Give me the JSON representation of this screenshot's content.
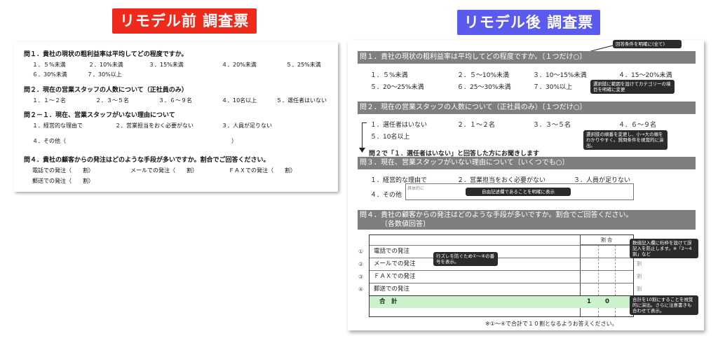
{
  "banners": {
    "before": "リモデル前 調査票",
    "after": "リモデル後 調査票"
  },
  "before": {
    "q1": {
      "title": "問１．貴社の現状の粗利益率は平均してどの程度ですか。",
      "options": [
        "１．５%未満",
        "２．10%未満",
        "３．15%未満",
        "４．20%未満",
        "５．25%未満",
        "６．30%未満",
        "７．30%以上"
      ]
    },
    "q2": {
      "title": "問２．現在の営業スタッフの人数について（正社員のみ）",
      "options": [
        "１．１～２名",
        "２．３～５名",
        "３．６～９名",
        "４．10名以上",
        "５．選任者はいない"
      ]
    },
    "q21": {
      "title": "問２－１．現在、営業スタッフがいない理由について",
      "options": [
        "１．経営的な理由で",
        "２．営業担当をおく必要がない",
        "３．人員が足りない",
        "４．その他（",
        "）"
      ]
    },
    "q4": {
      "title": "問４．貴社の顧客からの発注はどのような手段が多いですか。割合でご回答ください。",
      "items": [
        "電話での発注（　　割）",
        "メールでの発注（　　割）",
        "ＦＡＸでの発注（　　割）",
        "郵送での発注（　　割）"
      ]
    }
  },
  "after": {
    "notes": {
      "n1": "回答条件を明確に(全て)",
      "n2": "選択肢に範囲を設けてカテゴリーの境目を明確に変更",
      "n3": "選択肢の順番を変更し、小→大の順をわかりやすく。質問条件を視覚的に演出。",
      "n4": "自由記述欄であることを明確に表示",
      "n5": "行ズレを防ぐため①～④の番号を表示。",
      "n6": "数値記入欄に桁枠を設けて誤記入を防止します。※「2～4割」など",
      "n7": "合計を10割にすることを視覚的に演出。さらに注意書きも合わせて表示。"
    },
    "q1": {
      "title": "問１．貴社の現状の粗利益率は平均してどの程度ですか。〔１つだけ○〕",
      "options": [
        "１．５%未満",
        "２．５～10%未満",
        "３．10～15%未満",
        "４．15～20%未満",
        "５．20～25%未満",
        "６．25～30%未満",
        "７．30%以上"
      ]
    },
    "q2": {
      "title": "問２．現在の営業スタッフの人数について（正社員のみ）〔１つだけ○〕",
      "options": [
        "１．選任者はいない",
        "２．１～２名",
        "３．３～５名",
        "４．６～９名",
        "５．10名以上"
      ]
    },
    "branch": "問２で「１．選任者はいない」と回答した方にお聞きします",
    "q3": {
      "title": "問３．現在、営業スタッフがいない理由について〔いくつでも○〕",
      "options": [
        "１．経営的な理由で",
        "２．営業担当をおく必要がない",
        "３．人員が足りない",
        "４．その他"
      ],
      "free_label": "具体的に"
    },
    "q4": {
      "title": "問４．貴社の顧客からの発注はどのような手段が多いですか。割合でご回答ください。",
      "subtitle": "〔各数値回答〕",
      "col_header": "割 合",
      "nums": [
        "①",
        "②",
        "③",
        "④"
      ],
      "rows": [
        "電話での発注",
        "メールでの発注",
        "ＦＡＸでの発注",
        "郵送での発注"
      ],
      "unit": "割",
      "total_label": "合　計",
      "total_values": [
        "1",
        "0"
      ],
      "footnote": "※①～④で合計で１０割となるようお答えください。"
    },
    "colors": {
      "bar": "#7f7f7f",
      "total_row": "#ccf2cc",
      "note": "#2b2b2b"
    }
  }
}
